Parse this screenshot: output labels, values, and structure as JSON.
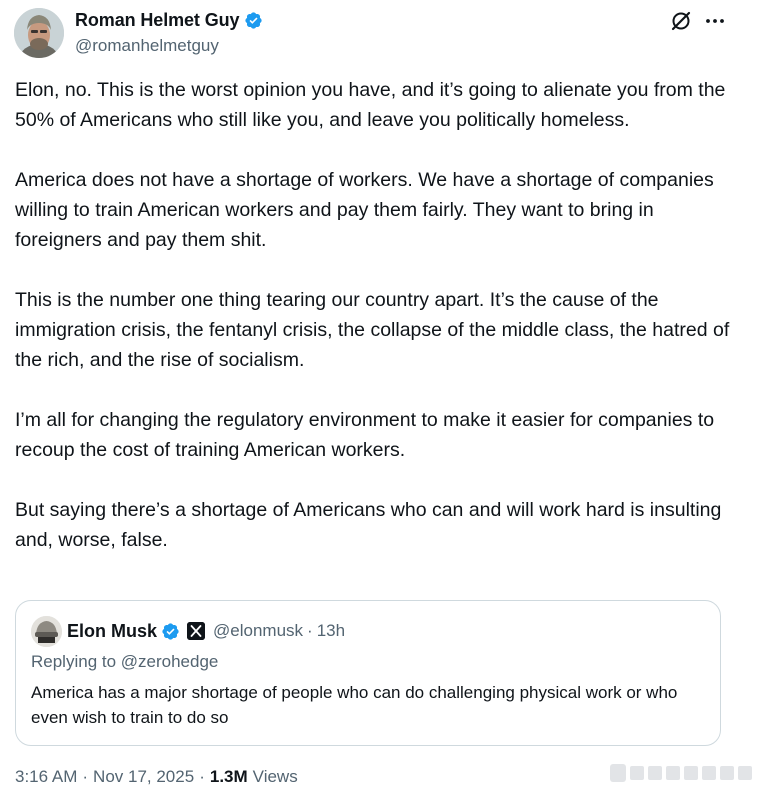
{
  "author": {
    "name": "Roman Helmet Guy",
    "handle": "@romanhelmetguy"
  },
  "icons": {
    "verified": "verified-badge-icon",
    "grok": "grok-icon",
    "more": "more-icon",
    "x_affiliate": "x-logo-icon"
  },
  "colors": {
    "verified": "#1d9bf0",
    "secondary_text": "#536471",
    "primary_text": "#0f1419",
    "border": "#cfd9de"
  },
  "tweet": {
    "paragraphs": [
      "Elon, no. This is the worst opinion you have, and it’s going to alienate you from the 50% of Americans who still like you, and leave you politically homeless.",
      "America does not have a shortage of workers. We have a shortage of companies willing to train American workers and pay them fairly. They want to bring in foreigners and pay them shit.",
      "This is the number one thing tearing our country apart. It’s the cause of the immigration crisis, the fentanyl crisis, the collapse of the middle class, the hatred of the rich, and the rise of socialism.",
      "I’m all for changing the regulatory environment to make it easier for companies to recoup the cost of training American workers.",
      "But saying there’s a shortage of Americans who can and will work hard is insulting and, worse, false."
    ]
  },
  "quote": {
    "name": "Elon Musk",
    "handle": "@elonmusk",
    "separator": "·",
    "time": "13h",
    "replying_to": "Replying to @zerohedge",
    "text": "America has a major shortage of people who can do challenging physical work or who even wish to train to do so"
  },
  "meta": {
    "time": "3:16 AM",
    "separator": "·",
    "date": "Nov 17, 2025",
    "views_count": "1.3M",
    "views_label": "Views"
  }
}
